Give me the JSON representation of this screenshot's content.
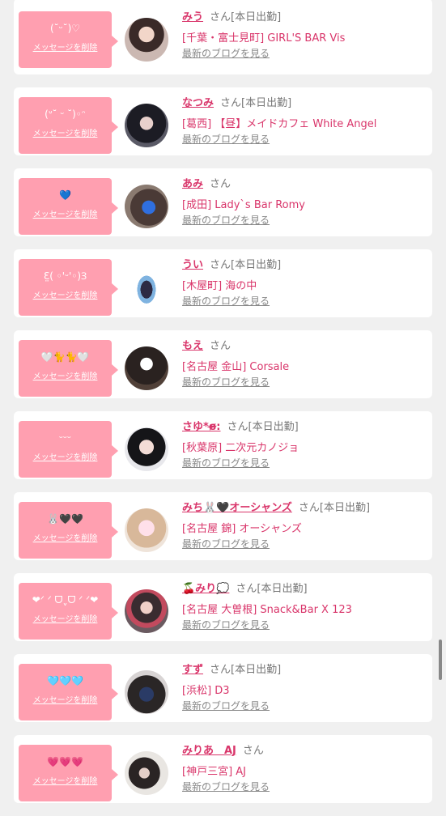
{
  "delete_label": "メッセージを削除",
  "san_label": "さん",
  "blog_link_label": "最新のブログを見る",
  "colors": {
    "accent_pink": "#ff9fb0",
    "name_text": "#d9356a",
    "muted_text": "#777777"
  },
  "girls": [
    {
      "message": "(˘ᵕ˘)♡",
      "name": "みう",
      "status": "[本日出勤]",
      "shop": "[千葉・富士見町] GIRL'S BAR Vis",
      "avatar": "photo-1"
    },
    {
      "message": "(ᐡ˘ ᵕ ˘)◦ᵔ",
      "name": "なつみ",
      "status": "[本日出勤]",
      "shop": "[葛西] 【昼】メイドカフェ White Angel",
      "avatar": "photo-2"
    },
    {
      "message": "💙",
      "name": "あみ",
      "status": "",
      "shop": "[成田] Lady`s Bar Romy",
      "avatar": "photo-3"
    },
    {
      "message": "Ɛ̤( ◦'ᵕ'◦)Ɜ",
      "name": "うい",
      "status": "[本日出勤]",
      "shop": "[木屋町] 海の中",
      "avatar": "photo-4"
    },
    {
      "message": "🤍🐈🐈🤍",
      "name": "もえ",
      "status": "",
      "shop": "[名古屋 金山] Corsale",
      "avatar": "photo-5"
    },
    {
      "message": "ᵕᵕᵕ",
      "name": "さゆ*ɞ̴̶̷:",
      "status": "[本日出勤]",
      "shop": "[秋葉原] 二次元カノジョ",
      "avatar": "photo-6"
    },
    {
      "message": "🐰🖤🖤",
      "name": "みち🐰🖤オーシャンズ",
      "status": "[本日出勤]",
      "shop": "[名古屋 錦] オーシャンズ",
      "avatar": "photo-7"
    },
    {
      "message": "❤︎ᐟ ᐟ ᗜˬᗜ ᐟ ᐟ❤︎",
      "name": "🍒みり💭",
      "status": "[本日出勤]",
      "shop": "[名古屋 大曽根] Snack&Bar X 123",
      "avatar": "photo-8"
    },
    {
      "message": "🩵🩵🩵",
      "name": "すず",
      "status": "[本日出勤]",
      "shop": "[浜松] D3",
      "avatar": "photo-9"
    },
    {
      "message": "💗💗💗",
      "name": "みりあ　AJ",
      "status": "",
      "shop": "[神戸三宮] AJ",
      "avatar": "photo-10"
    }
  ]
}
